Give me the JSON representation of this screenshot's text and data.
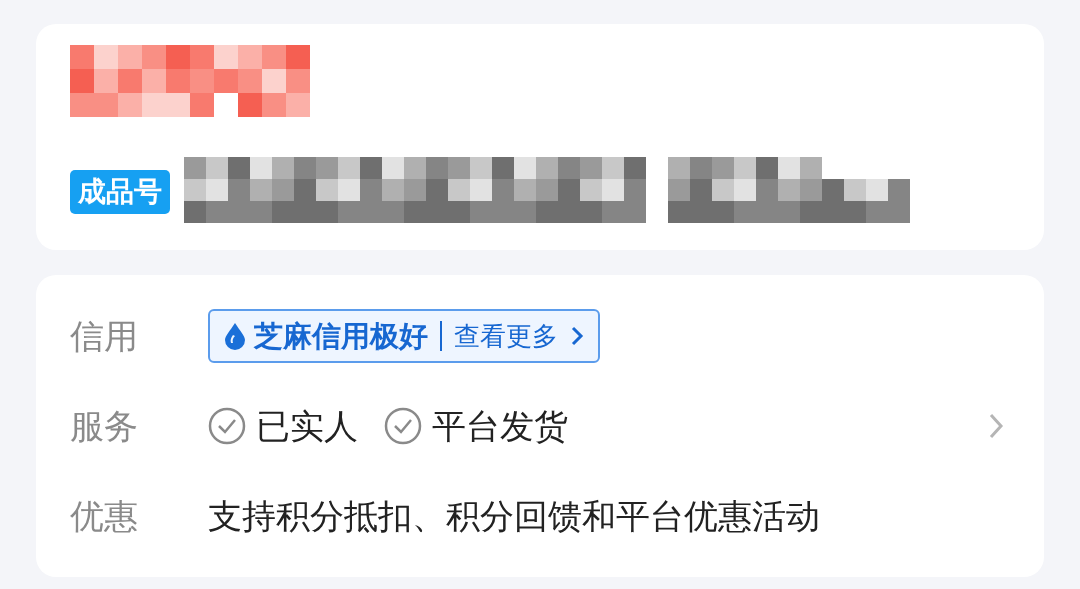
{
  "header": {
    "badge": "成品号"
  },
  "details": [
    {
      "kind": "credit",
      "label": "信用",
      "credit_text": "芝麻信用极好",
      "link": "查看更多"
    },
    {
      "kind": "services",
      "label": "服务",
      "items": [
        "已实人",
        "平台发货"
      ],
      "has_more": true
    },
    {
      "kind": "text",
      "label": "优惠",
      "text": "支持积分抵扣、积分回馈和平台优惠活动"
    }
  ]
}
